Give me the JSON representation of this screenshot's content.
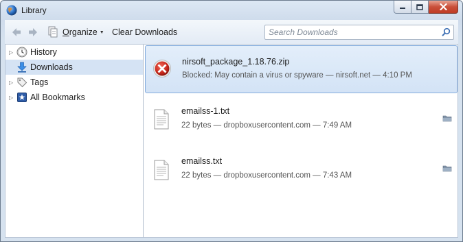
{
  "window": {
    "title": "Library"
  },
  "toolbar": {
    "organize_accel": "O",
    "organize_rest": "rganize",
    "clear_downloads": "Clear Downloads"
  },
  "search": {
    "placeholder": "Search Downloads"
  },
  "sidebar": {
    "items": [
      {
        "label": "History",
        "icon": "clock-icon",
        "expandable": true
      },
      {
        "label": "Downloads",
        "icon": "download-arrow-icon",
        "expandable": false,
        "selected": true
      },
      {
        "label": "Tags",
        "icon": "tag-icon",
        "expandable": true
      },
      {
        "label": "All Bookmarks",
        "icon": "star-bookmarks-icon",
        "expandable": true
      }
    ]
  },
  "downloads": [
    {
      "name": "nirsoft_package_1.18.76.zip",
      "status": "Blocked: May contain a virus or spyware — nirsoft.net — 4:10 PM",
      "icon": "blocked-error-icon",
      "selected": true
    },
    {
      "name": "emailss-1.txt",
      "status": "22 bytes — dropboxusercontent.com — 7:49 AM",
      "icon": "text-file-icon",
      "selected": false
    },
    {
      "name": "emailss.txt",
      "status": "22 bytes — dropboxusercontent.com — 7:43 AM",
      "icon": "text-file-icon",
      "selected": false
    }
  ],
  "colors": {
    "selection_bg": "#d5e3f4",
    "error_red": "#c8281c",
    "close_button": "#c9503a"
  }
}
